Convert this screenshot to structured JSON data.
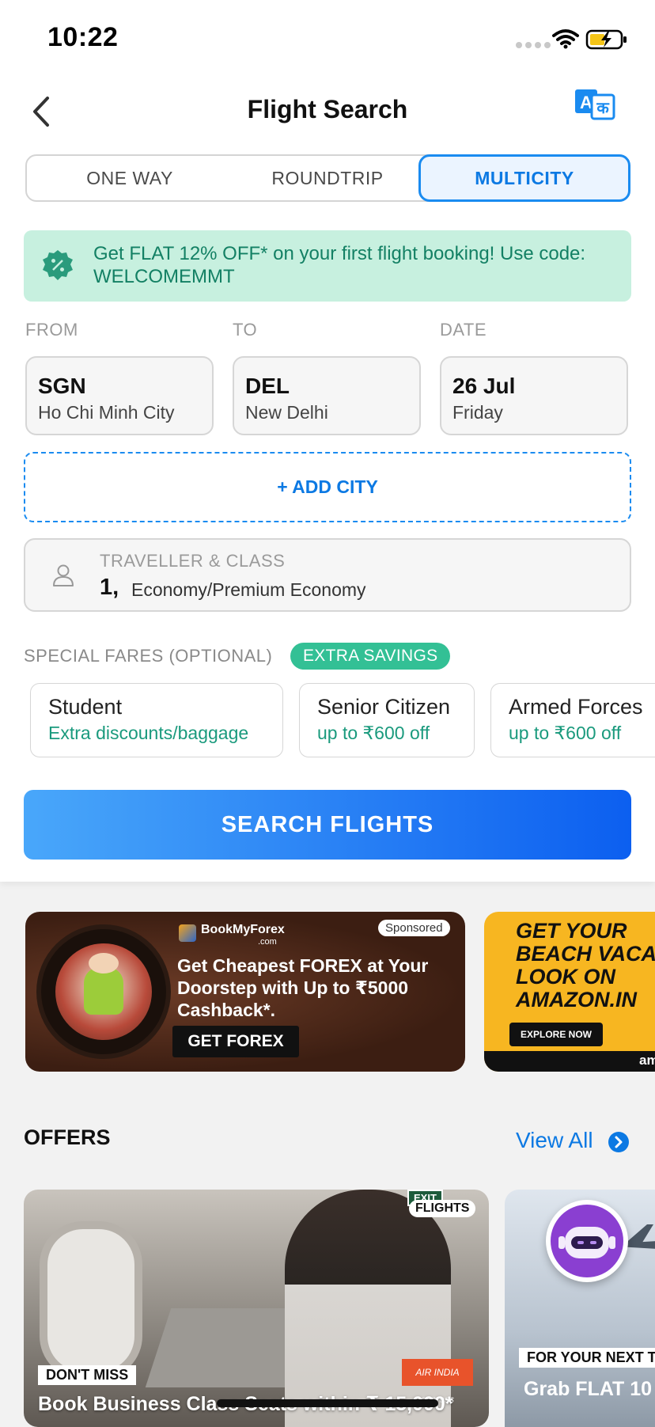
{
  "status_bar": {
    "time": "10:22"
  },
  "header": {
    "title": "Flight Search"
  },
  "trip_tabs": [
    {
      "label": "ONE WAY",
      "active": false
    },
    {
      "label": "ROUNDTRIP",
      "active": false
    },
    {
      "label": "MULTICITY",
      "active": true
    }
  ],
  "promo": {
    "text": "Get FLAT 12% OFF* on your first flight booking! Use code: WELCOMEMMT"
  },
  "labels": {
    "from": "FROM",
    "to": "TO",
    "date": "DATE"
  },
  "from": {
    "code": "SGN",
    "city": "Ho Chi Minh City"
  },
  "to": {
    "code": "DEL",
    "city": "New Delhi"
  },
  "date": {
    "day": "26 Jul",
    "weekday": "Friday"
  },
  "add_city": "+ ADD CITY",
  "traveller": {
    "label": "TRAVELLER & CLASS",
    "count": "1,",
    "class": "Economy/Premium Economy"
  },
  "special_fares": {
    "label": "SPECIAL FARES (OPTIONAL)",
    "badge": "EXTRA SAVINGS",
    "items": [
      {
        "title": "Student",
        "subtitle": "Extra discounts/baggage"
      },
      {
        "title": "Senior Citizen",
        "subtitle": "up to ₹600 off"
      },
      {
        "title": "Armed Forces",
        "subtitle": "up to ₹600 off"
      }
    ]
  },
  "search_button": "SEARCH FLIGHTS",
  "ads": {
    "forex": {
      "brand": "BookMyForex",
      "brand_domain": ".com",
      "sponsored": "Sponsored",
      "headline": "Get Cheapest FOREX at Your Doorstep with Up to ₹5000 Cashback*.",
      "cta": "GET FOREX"
    },
    "amazon": {
      "headline": "GET YOUR BEACH VACA LOOK ON AMAZON.IN",
      "cta": "EXPLORE NOW",
      "brand_partial": "am"
    }
  },
  "offers": {
    "title": "OFFERS",
    "view_all": "View All",
    "cards": [
      {
        "tag": "FLIGHTS",
        "badge": "DON'T MISS",
        "headline": "Book Business Class Seats within ₹ 15,000*",
        "airline_logo": "AIR INDIA express",
        "exit_sign": "EXIT"
      },
      {
        "badge": "FOR YOUR NEXT T",
        "headline": "Grab FLAT 10"
      }
    ]
  },
  "colors": {
    "accent": "#0c79e3",
    "promo_bg": "#c7f0df",
    "promo_text": "#138064",
    "badge_green": "#33c095"
  }
}
